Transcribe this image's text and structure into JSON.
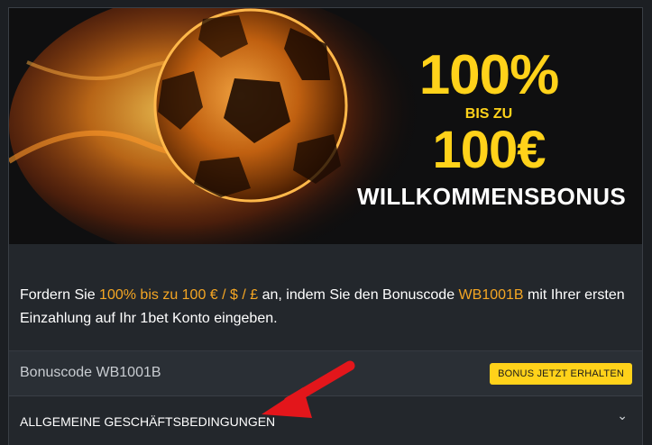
{
  "banner": {
    "line1": "100%",
    "line2": "BIS ZU",
    "line3": "100€",
    "line4": "WILLKOMMENSBONUS"
  },
  "description": {
    "part1": "Fordern Sie ",
    "highlight1": "100% bis zu 100 € / $ / £",
    "part2": " an, indem Sie den Bonuscode ",
    "highlight2": "WB1001B",
    "part3": " mit Ihrer ersten Einzahlung auf Ihr 1bet Konto eingeben."
  },
  "code_row": {
    "label": "Bonuscode WB1001B",
    "button": "BONUS JETZT ERHALTEN"
  },
  "terms": {
    "label": "ALLGEMEINE GESCHÄFTSBEDINGUNGEN",
    "chevron": "⌄"
  },
  "colors": {
    "accent_yellow": "#ffd21a",
    "highlight_orange": "#f5a623",
    "background": "#23272c",
    "arrow_red": "#e3161b"
  }
}
